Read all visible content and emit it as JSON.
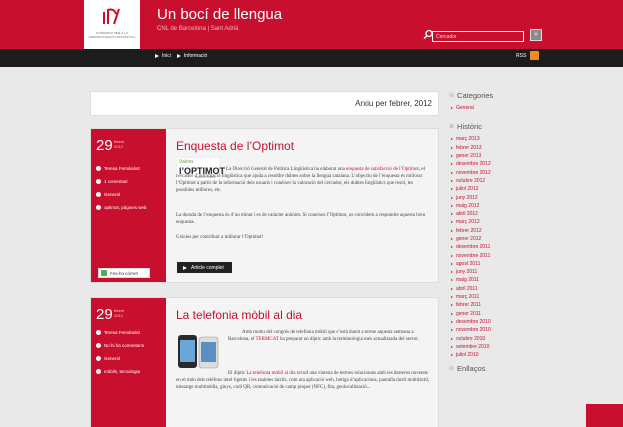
{
  "header": {
    "logo_text": "CONSORCI PER A LA NORMALITZACIÓ LINGÜÍSTICA",
    "title": "Un bocí de llengua",
    "subtitle": "CNL de Barcelona | Sant Adrià",
    "search_placeholder": "Cercador",
    "search_button": "»",
    "rss_label": "RSS"
  },
  "nav": {
    "items": [
      "Inici",
      "Informació"
    ]
  },
  "archive_title": "Arxiu per febrer, 2012",
  "posts": [
    {
      "day": "29",
      "month": "febrer",
      "year": "2012",
      "author": "Teresa Fernández",
      "comments": "1 comentari",
      "category": "General",
      "tags": "optimot, pàgines web",
      "facebook": "Fes-ho córrer!",
      "title": "Enquesta de l’Optimot",
      "logo": {
        "top": "Valora",
        "name": "l’OPTIMOT",
        "sub": "Opina-hi a millorar"
      },
      "p1_before": "La Direcció General de Política Lingüística ha elaborat una ",
      "p1_link": "enquesta de satisfacció de l’Optimot",
      "p1_after": ", el cercador d’informació lingüística que ajuda a resoldre dubtes sobre la llengua catalana. L’objectiu de l’enquesta és millorar l’Optimot a partir de la informació dels usuaris i conèixer la valoració del cercador, els dubtes lingüístics que resol, les possibles millores, etc.",
      "p2": "La durada de l’enquesta és d’un minut i es de caràcter anònim. Si coneixes l’Optimot, us convidem a respondre aquesta breu enquesta.",
      "p3": "Gràcies per contribuir a millorar l’Optimot!",
      "button": "Article complet"
    },
    {
      "day": "29",
      "month": "febrer",
      "year": "2012",
      "author": "Teresa Fernández",
      "comments": "No hi ha comentaris",
      "category": "General",
      "tags": "mòbils, tecnologia",
      "title": "La telefonia mòbil al dia",
      "p1_before": "Amb motiu del congrés de telefonia mòbil que s’està duent a terme aquesta setmana a Barcelona, el ",
      "p1_link": "TERMCAT",
      "p1_after": " ha preparat un díptic amb la terminologia més actualitzada del sector.",
      "p2_before": "El díptic ",
      "p2_link": "La telefonia mòbil al dia",
      "p2_after": " recull una vintena de termes relacionats amb les darreres novetats en el món dels telèfons intel·ligents i les tauletes tàctils, com ara aplicació web, botiga d’aplicacions, pantalla tàctil multitàctil, missatge multimèdia, ginys, codi QR, comunicació de camp proper (NFC), fita, geolocalització..."
    }
  ],
  "sidebar": {
    "categories_title": "Categories",
    "categories": [
      "General"
    ],
    "historic_title": "Històric",
    "months": [
      "març 2013",
      "febrer 2013",
      "gener 2013",
      "desembre 2012",
      "novembre 2012",
      "octubre 2012",
      "juliol 2012",
      "juny 2012",
      "maig 2012",
      "abril 2012",
      "març 2012",
      "febrer 2012",
      "gener 2012",
      "desembre 2011",
      "novembre 2011",
      "agost 2011",
      "juny 2011",
      "maig 2011",
      "abril 2011",
      "març 2011",
      "febrer 2011",
      "gener 2011",
      "desembre 2010",
      "novembre 2010",
      "octubre 2010",
      "setembre 2010",
      "juliol 2010"
    ],
    "links_title": "Enllaços"
  },
  "colors": {
    "brand": "#c8102e",
    "nav": "#1c1c1c",
    "rss": "#f08a24"
  }
}
